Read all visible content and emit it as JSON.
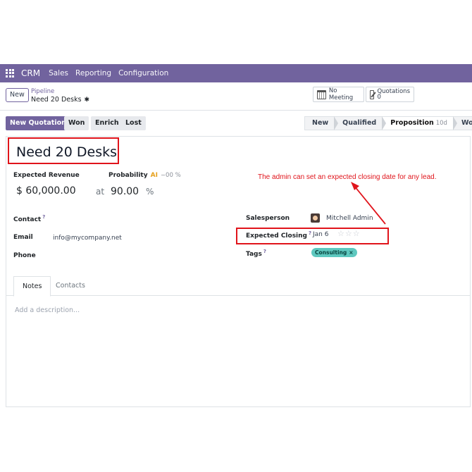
{
  "navbar": {
    "app_name": "CRM",
    "menu": [
      "Sales",
      "Reporting",
      "Configuration"
    ]
  },
  "control_panel": {
    "new_label": "New",
    "breadcrumb_parent": "Pipeline",
    "breadcrumb_current": "Need 20 Desks",
    "smart_buttons": {
      "meeting_label": "No Meeting",
      "quotations_label": "Quotations",
      "quotations_count": "0"
    }
  },
  "status_bar": {
    "actions": [
      "New Quotation",
      "Won",
      "Enrich",
      "Lost"
    ],
    "stages": [
      {
        "label": "New",
        "duration": ""
      },
      {
        "label": "Qualified",
        "duration": ""
      },
      {
        "label": "Proposition",
        "duration": "10d"
      },
      {
        "label": "Won",
        "duration": ""
      }
    ],
    "active_stage": "Proposition"
  },
  "form": {
    "title": "Need 20 Desks",
    "expected_revenue_label": "Expected Revenue",
    "expected_revenue": "$ 60,000.00",
    "at_label": "at",
    "probability_label": "Probability",
    "ai_label": "AI",
    "ai_value": "−00 %",
    "probability_value": "90.00",
    "percent_sign": "%",
    "contact_label": "Contact",
    "email_label": "Email",
    "email_value": "info@mycompany.net",
    "phone_label": "Phone",
    "help_mark": "?",
    "salesperson_label": "Salesperson",
    "salesperson_value": "Mitchell Admin",
    "expected_closing_label": "Expected Closing",
    "expected_closing_value": "Jan 6",
    "priority_stars": "☆☆☆",
    "tags_label": "Tags",
    "tag_value": "Consulting",
    "tag_remove": "×"
  },
  "annotation": {
    "text": "The admin can set an expected closing date for any lead.",
    "color": "#e0141b"
  },
  "notebook": {
    "tabs": [
      "Notes",
      "Contacts"
    ],
    "active_tab": "Notes",
    "description_placeholder": "Add a description..."
  },
  "colors": {
    "brand": "#71639e",
    "tag": "#5ec8bf",
    "highlight": "#e0141b"
  }
}
